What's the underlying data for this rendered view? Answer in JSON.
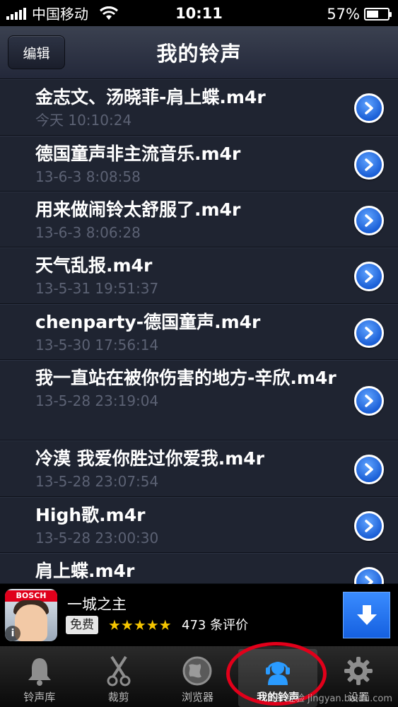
{
  "status": {
    "carrier": "中国移动",
    "time": "10:11",
    "battery": "57%",
    "battery_level": 0.57
  },
  "nav": {
    "edit_label": "编辑",
    "title": "我的铃声"
  },
  "ringtones": [
    {
      "title": "金志文、汤晓菲-肩上蝶.m4r",
      "date": "今天 10:10:24"
    },
    {
      "title": "德国童声非主流音乐.m4r",
      "date": "13-6-3 8:08:58"
    },
    {
      "title": "用来做闹铃太舒服了.m4r",
      "date": "13-6-3 8:06:28"
    },
    {
      "title": "天气乱报.m4r",
      "date": "13-5-31 19:51:37"
    },
    {
      "title": "chenparty-德国童声.m4r",
      "date": "13-5-30 17:56:14"
    },
    {
      "title": "我一直站在被你伤害的地方-辛欣.m4r",
      "date": "13-5-28 23:19:04"
    },
    {
      "title": "冷漠 我爱你胜过你爱我.m4r",
      "date": "13-5-28 23:07:54"
    },
    {
      "title": "High歌.m4r",
      "date": "13-5-28 23:00:30"
    },
    {
      "title": "肩上蝶.m4r",
      "date": ""
    }
  ],
  "ad": {
    "brand": "BOSCH",
    "title": "一城之主",
    "free_label": "免费",
    "stars": "★★★★★",
    "rating": 4.5,
    "reviews": "473 条评价"
  },
  "tabs": [
    {
      "label": "铃声库",
      "icon": "bell-icon"
    },
    {
      "label": "裁剪",
      "icon": "scissors-icon"
    },
    {
      "label": "浏览器",
      "icon": "globe-icon"
    },
    {
      "label": "我的铃声",
      "icon": "headphones-icon"
    },
    {
      "label": "设置",
      "icon": "gear-icon"
    }
  ],
  "watermark": "Bai 经验 jingyan.baidu.com",
  "colors": {
    "accent": "#1b5fd6",
    "highlight_circle": "#e2001a"
  }
}
